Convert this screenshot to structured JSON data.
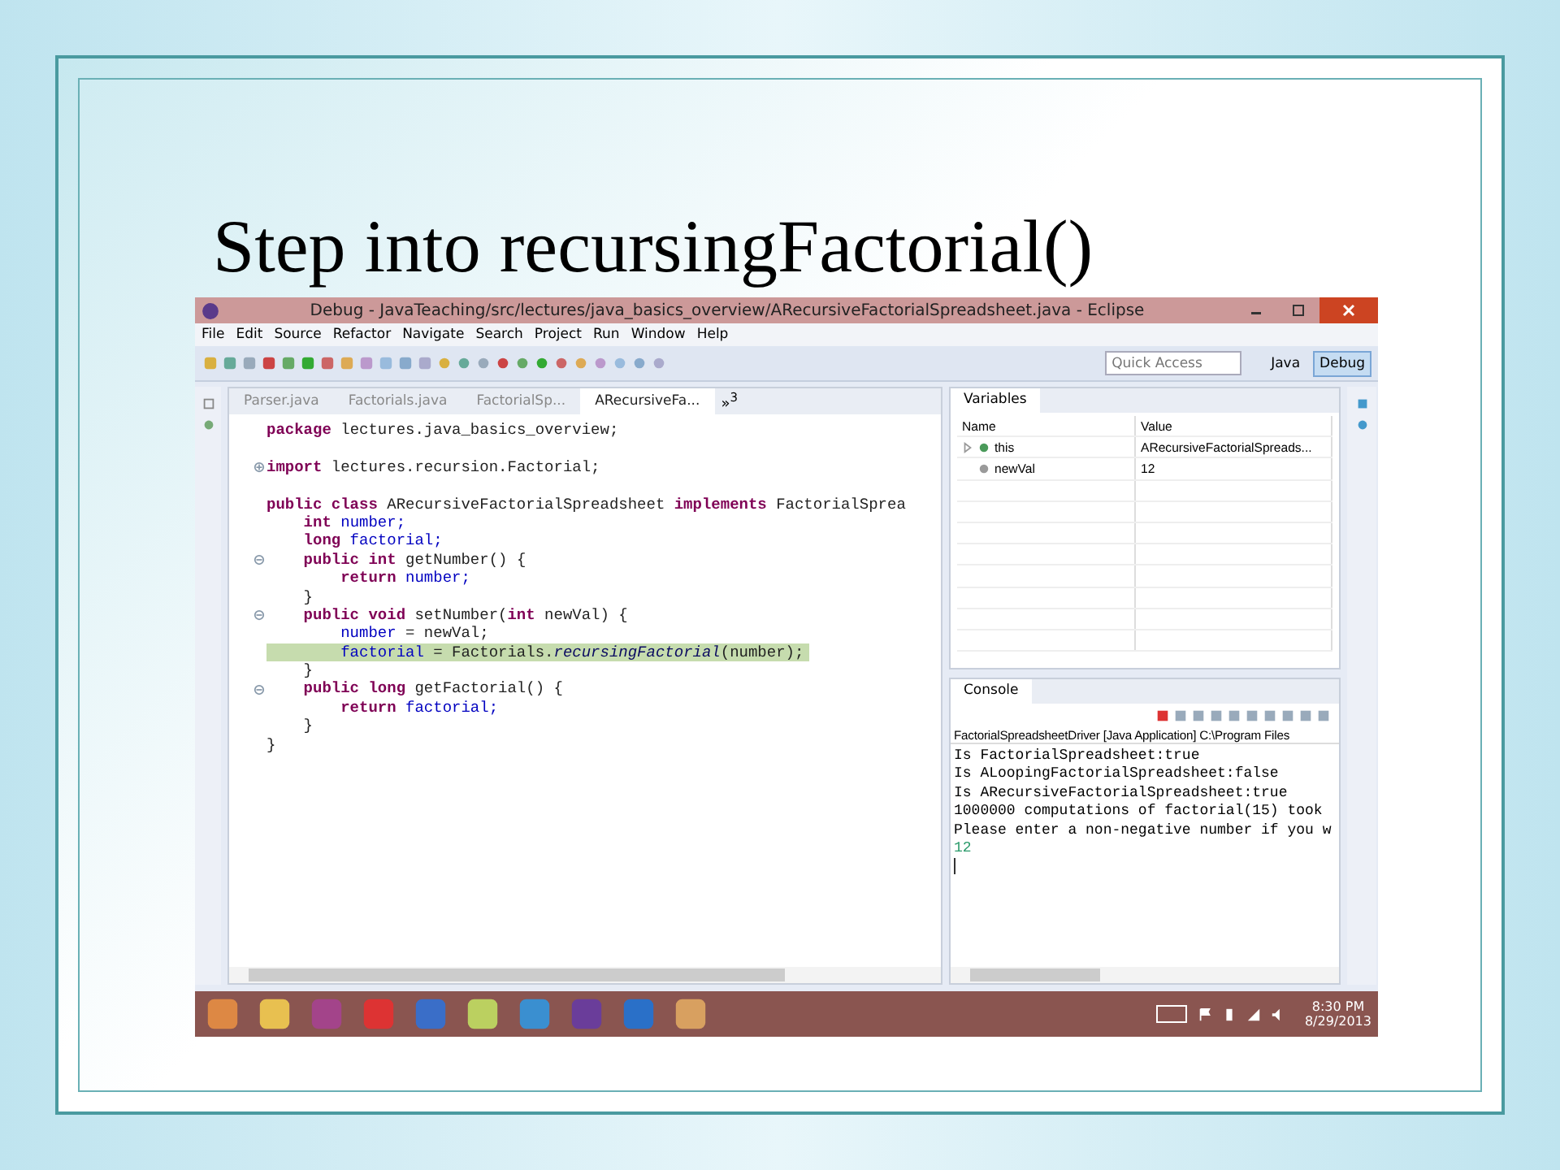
{
  "slide": {
    "title": "Step into recursingFactorial()"
  },
  "window": {
    "title": "Debug - JavaTeaching/src/lectures/java_basics_overview/ARecursiveFactorialSpreadsheet.java - Eclipse"
  },
  "menu": [
    "File",
    "Edit",
    "Source",
    "Refactor",
    "Navigate",
    "Search",
    "Project",
    "Run",
    "Window",
    "Help"
  ],
  "quick_access": {
    "placeholder": "Quick Access"
  },
  "perspectives": [
    {
      "label": "Java",
      "selected": false
    },
    {
      "label": "Debug",
      "selected": true
    }
  ],
  "editor": {
    "tabs": [
      {
        "label": "Parser.java",
        "selected": false
      },
      {
        "label": "Factorials.java",
        "selected": false
      },
      {
        "label": "FactorialSp...",
        "selected": false
      },
      {
        "label": "ARecursiveFa...",
        "selected": true
      }
    ],
    "overflow": "»",
    "overflow_count": "3",
    "lines": [
      {
        "segments": [
          {
            "t": "package",
            "kind": "kw"
          },
          {
            "t": " lectures.java_basics_overview;",
            "kind": "plain"
          }
        ]
      },
      {
        "blank_before": true,
        "folded": true,
        "segments": [
          {
            "t": "import",
            "kind": "kw"
          },
          {
            "t": " lectures.recursion.Factorial;",
            "kind": "plain"
          }
        ]
      },
      {
        "blank_before": true,
        "segments": [
          {
            "t": "public class",
            "kind": "kw"
          },
          {
            "t": " ARecursiveFactorialSpreadsheet ",
            "kind": "plain"
          },
          {
            "t": "implements",
            "kind": "kw"
          },
          {
            "t": " FactorialSprea",
            "kind": "plain"
          }
        ]
      },
      {
        "segments": [
          {
            "t": "    int",
            "kind": "kw"
          },
          {
            "t": " number;",
            "kind": "id"
          }
        ]
      },
      {
        "segments": [
          {
            "t": "    long",
            "kind": "kw"
          },
          {
            "t": " factorial;",
            "kind": "id"
          }
        ]
      },
      {
        "fold": true,
        "segments": [
          {
            "t": "    public int",
            "kind": "kw"
          },
          {
            "t": " getNumber() {",
            "kind": "plain"
          }
        ]
      },
      {
        "segments": [
          {
            "t": "        return",
            "kind": "kw"
          },
          {
            "t": " number;",
            "kind": "id"
          }
        ]
      },
      {
        "segments": [
          {
            "t": "    }",
            "kind": "plain"
          }
        ]
      },
      {
        "fold": true,
        "segments": [
          {
            "t": "    public void",
            "kind": "kw"
          },
          {
            "t": " setNumber(",
            "kind": "plain"
          },
          {
            "t": "int",
            "kind": "kw"
          },
          {
            "t": " newVal) {",
            "kind": "plain"
          }
        ]
      },
      {
        "segments": [
          {
            "t": "        number",
            "kind": "id"
          },
          {
            "t": " = newVal;",
            "kind": "plain"
          }
        ]
      },
      {
        "current": true,
        "segments": [
          {
            "t": "        factorial",
            "kind": "id"
          },
          {
            "t": " = Factorials.",
            "kind": "plain"
          },
          {
            "t": "recursingFactorial",
            "kind": "it"
          },
          {
            "t": "(number);",
            "kind": "plain"
          }
        ]
      },
      {
        "segments": [
          {
            "t": "    }",
            "kind": "plain"
          }
        ]
      },
      {
        "fold": true,
        "segments": [
          {
            "t": "    public long",
            "kind": "kw"
          },
          {
            "t": " getFactorial() {",
            "kind": "plain"
          }
        ]
      },
      {
        "segments": [
          {
            "t": "        return",
            "kind": "kw"
          },
          {
            "t": " factorial;",
            "kind": "id"
          }
        ]
      },
      {
        "segments": [
          {
            "t": "    }",
            "kind": "plain"
          }
        ]
      },
      {
        "segments": [
          {
            "t": "}",
            "kind": "plain"
          }
        ]
      }
    ]
  },
  "variables": {
    "title": "Variables",
    "columns": [
      "Name",
      "Value"
    ],
    "rows": [
      {
        "name": "this",
        "value": "ARecursiveFactorialSpreads...",
        "expandable": true,
        "color": "#4a9a5a"
      },
      {
        "name": "newVal",
        "value": "12",
        "expandable": false,
        "color": "#9a9a9a"
      }
    ]
  },
  "console": {
    "title": "Console",
    "process": "FactorialSpreadsheetDriver [Java Application] C:\\Program Files",
    "lines": [
      {
        "text": "Is FactorialSpreadsheet:true",
        "kind": "output"
      },
      {
        "text": "Is ALoopingFactorialSpreadsheet:false",
        "kind": "output"
      },
      {
        "text": "Is ARecursiveFactorialSpreadsheet:true",
        "kind": "output"
      },
      {
        "text": "1000000 computations of factorial(15) took",
        "kind": "output"
      },
      {
        "text": "Please enter a non-negative number if you w",
        "kind": "output"
      },
      {
        "text": "12",
        "kind": "input"
      }
    ]
  },
  "taskbar": {
    "time": "8:30 PM",
    "date": "8/29/2013"
  }
}
